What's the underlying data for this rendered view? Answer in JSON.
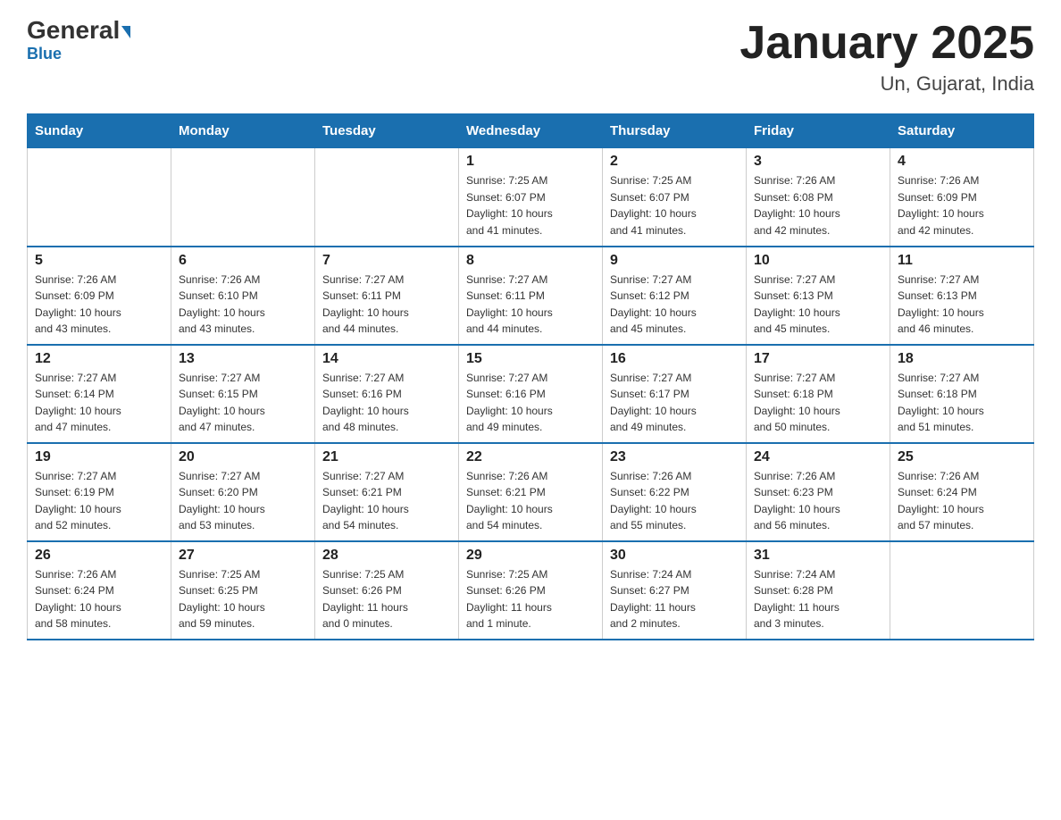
{
  "logo": {
    "general": "General",
    "blue": "Blue"
  },
  "title": "January 2025",
  "subtitle": "Un, Gujarat, India",
  "days_of_week": [
    "Sunday",
    "Monday",
    "Tuesday",
    "Wednesday",
    "Thursday",
    "Friday",
    "Saturday"
  ],
  "weeks": [
    [
      {
        "day": "",
        "info": ""
      },
      {
        "day": "",
        "info": ""
      },
      {
        "day": "",
        "info": ""
      },
      {
        "day": "1",
        "info": "Sunrise: 7:25 AM\nSunset: 6:07 PM\nDaylight: 10 hours\nand 41 minutes."
      },
      {
        "day": "2",
        "info": "Sunrise: 7:25 AM\nSunset: 6:07 PM\nDaylight: 10 hours\nand 41 minutes."
      },
      {
        "day": "3",
        "info": "Sunrise: 7:26 AM\nSunset: 6:08 PM\nDaylight: 10 hours\nand 42 minutes."
      },
      {
        "day": "4",
        "info": "Sunrise: 7:26 AM\nSunset: 6:09 PM\nDaylight: 10 hours\nand 42 minutes."
      }
    ],
    [
      {
        "day": "5",
        "info": "Sunrise: 7:26 AM\nSunset: 6:09 PM\nDaylight: 10 hours\nand 43 minutes."
      },
      {
        "day": "6",
        "info": "Sunrise: 7:26 AM\nSunset: 6:10 PM\nDaylight: 10 hours\nand 43 minutes."
      },
      {
        "day": "7",
        "info": "Sunrise: 7:27 AM\nSunset: 6:11 PM\nDaylight: 10 hours\nand 44 minutes."
      },
      {
        "day": "8",
        "info": "Sunrise: 7:27 AM\nSunset: 6:11 PM\nDaylight: 10 hours\nand 44 minutes."
      },
      {
        "day": "9",
        "info": "Sunrise: 7:27 AM\nSunset: 6:12 PM\nDaylight: 10 hours\nand 45 minutes."
      },
      {
        "day": "10",
        "info": "Sunrise: 7:27 AM\nSunset: 6:13 PM\nDaylight: 10 hours\nand 45 minutes."
      },
      {
        "day": "11",
        "info": "Sunrise: 7:27 AM\nSunset: 6:13 PM\nDaylight: 10 hours\nand 46 minutes."
      }
    ],
    [
      {
        "day": "12",
        "info": "Sunrise: 7:27 AM\nSunset: 6:14 PM\nDaylight: 10 hours\nand 47 minutes."
      },
      {
        "day": "13",
        "info": "Sunrise: 7:27 AM\nSunset: 6:15 PM\nDaylight: 10 hours\nand 47 minutes."
      },
      {
        "day": "14",
        "info": "Sunrise: 7:27 AM\nSunset: 6:16 PM\nDaylight: 10 hours\nand 48 minutes."
      },
      {
        "day": "15",
        "info": "Sunrise: 7:27 AM\nSunset: 6:16 PM\nDaylight: 10 hours\nand 49 minutes."
      },
      {
        "day": "16",
        "info": "Sunrise: 7:27 AM\nSunset: 6:17 PM\nDaylight: 10 hours\nand 49 minutes."
      },
      {
        "day": "17",
        "info": "Sunrise: 7:27 AM\nSunset: 6:18 PM\nDaylight: 10 hours\nand 50 minutes."
      },
      {
        "day": "18",
        "info": "Sunrise: 7:27 AM\nSunset: 6:18 PM\nDaylight: 10 hours\nand 51 minutes."
      }
    ],
    [
      {
        "day": "19",
        "info": "Sunrise: 7:27 AM\nSunset: 6:19 PM\nDaylight: 10 hours\nand 52 minutes."
      },
      {
        "day": "20",
        "info": "Sunrise: 7:27 AM\nSunset: 6:20 PM\nDaylight: 10 hours\nand 53 minutes."
      },
      {
        "day": "21",
        "info": "Sunrise: 7:27 AM\nSunset: 6:21 PM\nDaylight: 10 hours\nand 54 minutes."
      },
      {
        "day": "22",
        "info": "Sunrise: 7:26 AM\nSunset: 6:21 PM\nDaylight: 10 hours\nand 54 minutes."
      },
      {
        "day": "23",
        "info": "Sunrise: 7:26 AM\nSunset: 6:22 PM\nDaylight: 10 hours\nand 55 minutes."
      },
      {
        "day": "24",
        "info": "Sunrise: 7:26 AM\nSunset: 6:23 PM\nDaylight: 10 hours\nand 56 minutes."
      },
      {
        "day": "25",
        "info": "Sunrise: 7:26 AM\nSunset: 6:24 PM\nDaylight: 10 hours\nand 57 minutes."
      }
    ],
    [
      {
        "day": "26",
        "info": "Sunrise: 7:26 AM\nSunset: 6:24 PM\nDaylight: 10 hours\nand 58 minutes."
      },
      {
        "day": "27",
        "info": "Sunrise: 7:25 AM\nSunset: 6:25 PM\nDaylight: 10 hours\nand 59 minutes."
      },
      {
        "day": "28",
        "info": "Sunrise: 7:25 AM\nSunset: 6:26 PM\nDaylight: 11 hours\nand 0 minutes."
      },
      {
        "day": "29",
        "info": "Sunrise: 7:25 AM\nSunset: 6:26 PM\nDaylight: 11 hours\nand 1 minute."
      },
      {
        "day": "30",
        "info": "Sunrise: 7:24 AM\nSunset: 6:27 PM\nDaylight: 11 hours\nand 2 minutes."
      },
      {
        "day": "31",
        "info": "Sunrise: 7:24 AM\nSunset: 6:28 PM\nDaylight: 11 hours\nand 3 minutes."
      },
      {
        "day": "",
        "info": ""
      }
    ]
  ]
}
